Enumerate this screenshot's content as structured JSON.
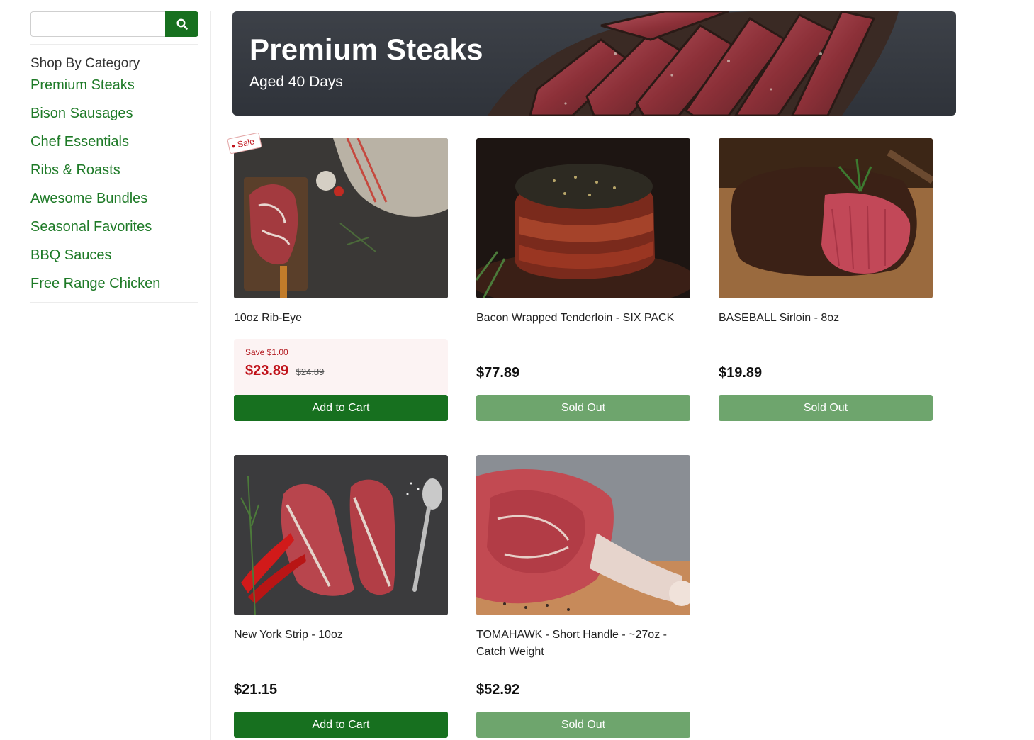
{
  "search": {
    "placeholder": "",
    "value": "",
    "button_icon": "search-icon"
  },
  "sidebar": {
    "title": "Shop By Category",
    "categories": [
      "Premium Steaks",
      "Bison Sausages",
      "Chef Essentials",
      "Ribs & Roasts",
      "Awesome Bundles",
      "Seasonal Favorites",
      "BBQ Sauces",
      "Free Range Chicken"
    ]
  },
  "banner": {
    "title": "Premium Steaks",
    "subtitle": "Aged 40 Days"
  },
  "products": [
    {
      "name": "10oz Rib-Eye",
      "badge": "Sale",
      "save": "Save $1.00",
      "price": "$23.89",
      "old_price": "$24.89",
      "button": "Add to Cart"
    },
    {
      "name": "Bacon Wrapped Tenderloin - SIX PACK",
      "price": "$77.89",
      "button": "Sold Out"
    },
    {
      "name": "BASEBALL Sirloin - 8oz",
      "price": "$19.89",
      "button": "Sold Out"
    },
    {
      "name": "New York Strip - 10oz",
      "price": "$21.15",
      "button": "Add to Cart"
    },
    {
      "name": "TOMAHAWK - Short Handle - ~27oz - Catch Weight",
      "price": "$52.92",
      "button": "Sold Out"
    }
  ],
  "colors": {
    "brand_green": "#17701f",
    "link_green": "#1e7a27",
    "sold_out_green": "#6ea56d",
    "sale_red": "#c0121a",
    "sale_bg": "#fcf3f3"
  }
}
